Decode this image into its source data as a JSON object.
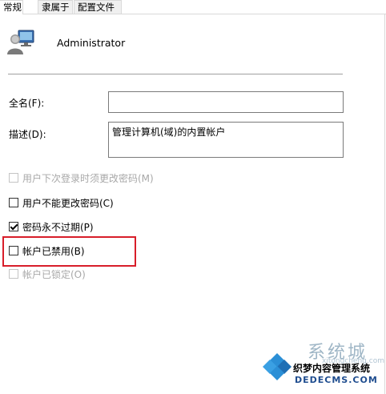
{
  "tabs": [
    {
      "label": "常规"
    },
    {
      "label": "隶属于"
    },
    {
      "label": "配置文件"
    }
  ],
  "user": {
    "name": "Administrator",
    "icon": "user-account-icon"
  },
  "form": {
    "fullname_label": "全名(F):",
    "fullname_value": "",
    "desc_label": "描述(D):",
    "desc_value": "管理计算机(域)的内置帐户"
  },
  "options": [
    {
      "label": "用户下次登录时须更改密码(M)",
      "checked": false,
      "disabled": true
    },
    {
      "label": "用户不能更改密码(C)",
      "checked": false,
      "disabled": false
    },
    {
      "label": "密码永不过期(P)",
      "checked": true,
      "disabled": false
    },
    {
      "label": "帐户已禁用(B)",
      "checked": false,
      "disabled": false
    },
    {
      "label": "帐户已锁定(O)",
      "checked": false,
      "disabled": true
    }
  ],
  "highlight_color": "#d81e2a",
  "watermark": {
    "title": "系统城",
    "pinyin": "xitongcheng.com",
    "subtitle": "织梦内容管理系统",
    "url": "DEDECMS.COM"
  }
}
